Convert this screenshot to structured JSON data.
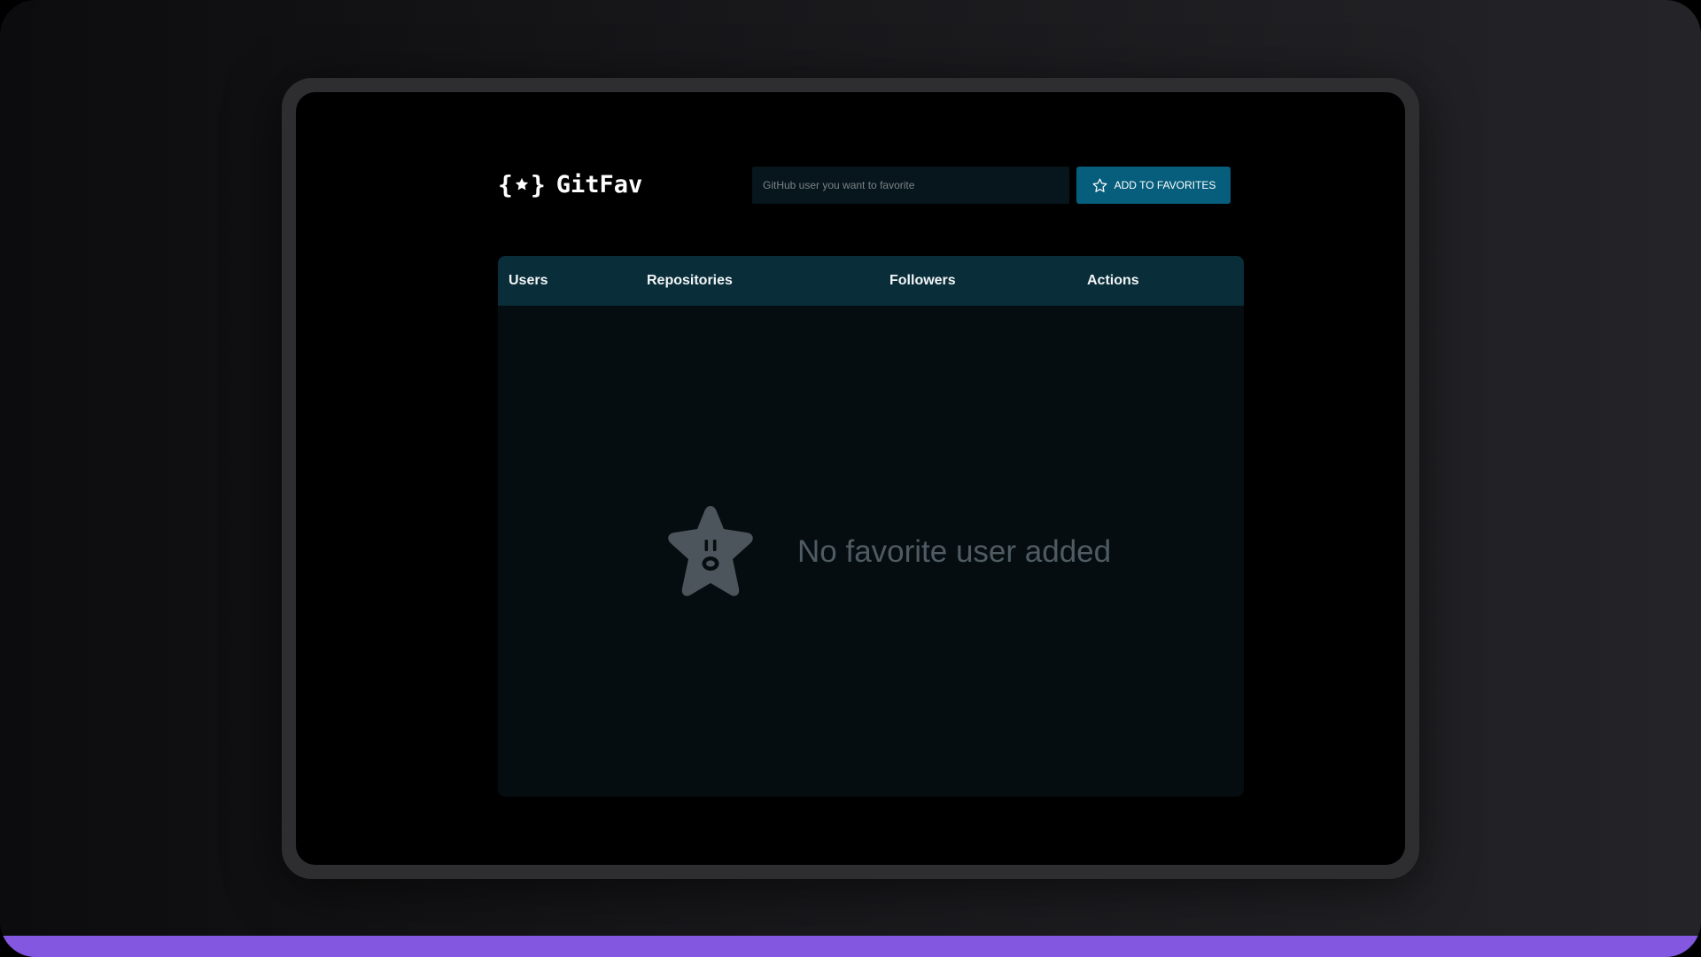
{
  "app": {
    "name": "GitFav"
  },
  "header": {
    "search_placeholder": "GitHub user you want to favorite",
    "search_value": "",
    "add_button_label": "ADD TO FAVORITES"
  },
  "table": {
    "columns": [
      "Users",
      "Repositories",
      "Followers",
      "Actions"
    ],
    "rows": [],
    "empty_message": "No favorite user added"
  },
  "icons": {
    "logo": "star-braces-logo",
    "add": "star-outline-icon",
    "empty": "surprised-star-icon"
  },
  "colors": {
    "accent_bar": "#8357e0",
    "button": "#065e7c",
    "table_header": "#092d39",
    "empty_text": "#4f5b62"
  }
}
